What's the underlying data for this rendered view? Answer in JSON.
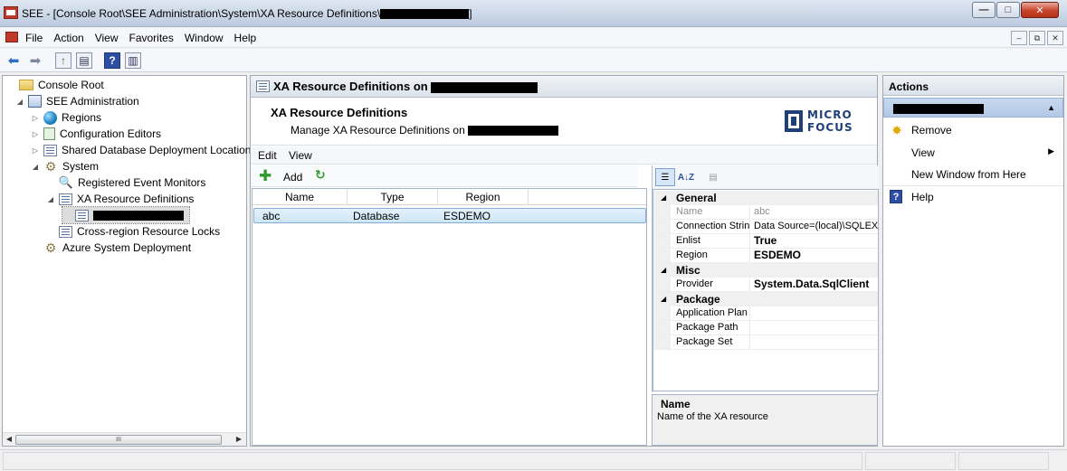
{
  "window": {
    "title": "SEE - [Console Root\\SEE Administration\\System\\XA Resource Definitions\\",
    "title_end": "]",
    "min": "—",
    "max": "□",
    "close": "✕"
  },
  "menu": {
    "items": [
      "File",
      "Action",
      "View",
      "Favorites",
      "Window",
      "Help"
    ],
    "child_min": "–",
    "child_restore": "⧉",
    "child_close": "✕"
  },
  "toolbar": {
    "back": "⬅",
    "forward": "➡",
    "up_folder": "↑",
    "show_hide": "▤",
    "help": "?",
    "show_action": "▥"
  },
  "tree": {
    "items": [
      {
        "label": "Console Root",
        "icon": "folder-icon",
        "level": 0,
        "expander": ""
      },
      {
        "label": "SEE Administration",
        "icon": "admin-icon",
        "level": 1,
        "expander": "◢"
      },
      {
        "label": "Regions",
        "icon": "globe-icon",
        "level": 2,
        "expander": "▷"
      },
      {
        "label": "Configuration Editors",
        "icon": "doc-icon",
        "level": 2,
        "expander": "▷"
      },
      {
        "label": "Shared Database Deployment Location",
        "icon": "list-icon",
        "level": 2,
        "expander": "▷"
      },
      {
        "label": "System",
        "icon": "gear-icon",
        "level": 2,
        "expander": "◢"
      },
      {
        "label": "Registered Event Monitors",
        "icon": "magnifier-icon",
        "level": 3,
        "expander": ""
      },
      {
        "label": "XA Resource Definitions",
        "icon": "list-icon",
        "level": 3,
        "expander": "◢"
      },
      {
        "label": "",
        "icon": "list-icon",
        "level": 4,
        "expander": "",
        "redacted": true
      },
      {
        "label": "Cross-region Resource Locks",
        "icon": "list-icon",
        "level": 3,
        "expander": ""
      },
      {
        "label": "Azure System Deployment",
        "icon": "gear-icon",
        "level": 2,
        "expander": ""
      }
    ],
    "scroll_left": "◀",
    "scroll_right": "▶",
    "scroll_grip": "III"
  },
  "center": {
    "header_title": "XA Resource Definitions on",
    "banner_title": "XA Resource Definitions",
    "banner_subtitle": "Manage XA Resource Definitions on",
    "logo_line1": "MICRO",
    "logo_line2": "FOCUS",
    "menu": [
      "Edit",
      "View"
    ],
    "add_icon": "✚",
    "add_label": "Add",
    "refresh_icon": "↻"
  },
  "list": {
    "columns": [
      "Name",
      "Type",
      "Region"
    ],
    "rows": [
      {
        "name": "abc",
        "type": "Database",
        "region": "ESDEMO"
      }
    ]
  },
  "properties": {
    "toolbar": {
      "categorized": "☰",
      "alphabetical": "A↓Z",
      "pages": "▤"
    },
    "categories": [
      {
        "name": "General",
        "rows": [
          {
            "key": "Name",
            "value": "abc",
            "readonly": true
          },
          {
            "key": "Connection String",
            "value": "Data Source=(local)\\SQLEXPRESS",
            "bold": false
          },
          {
            "key": "Enlist",
            "value": "True",
            "bold": true
          },
          {
            "key": "Region",
            "value": "ESDEMO",
            "bold": true
          }
        ]
      },
      {
        "name": "Misc",
        "rows": [
          {
            "key": "Provider",
            "value": "System.Data.SqlClient",
            "bold": true
          }
        ]
      },
      {
        "name": "Package",
        "rows": [
          {
            "key": "Application Plan",
            "value": ""
          },
          {
            "key": "Package Path",
            "value": ""
          },
          {
            "key": "Package Set",
            "value": ""
          }
        ]
      }
    ],
    "collapse_glyph": "◢",
    "description_title": "Name",
    "description_text": "Name of the XA resource"
  },
  "actions": {
    "title": "Actions",
    "collapse": "▲",
    "items": [
      {
        "label": "Remove",
        "icon": "remove-icon",
        "glyph": "✸"
      },
      {
        "label": "View",
        "icon": "",
        "glyph": "",
        "submenu": "▶"
      },
      {
        "label": "New Window from Here",
        "icon": "",
        "glyph": ""
      },
      {
        "label": "Help",
        "icon": "help-icon",
        "glyph": "?"
      }
    ]
  }
}
